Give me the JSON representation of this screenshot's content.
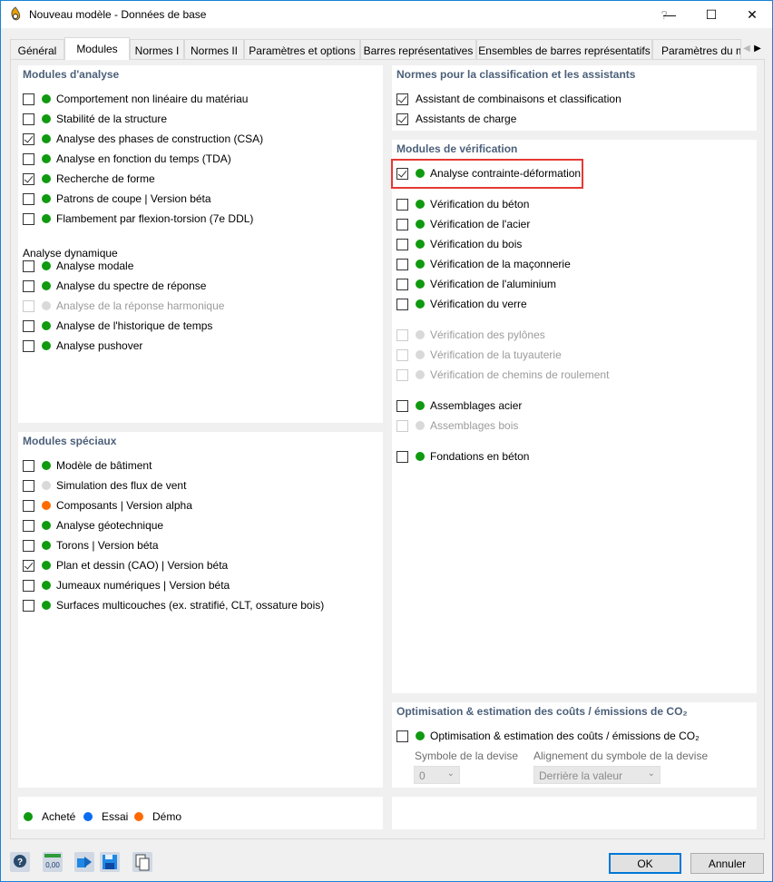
{
  "window": {
    "title": "Nouveau modèle - Données de base",
    "help_glyph": "?",
    "minimize_glyph": "—",
    "maximize_glyph": "☐",
    "close_glyph": "✕"
  },
  "tabs": [
    {
      "label": "Général"
    },
    {
      "label": "Modules",
      "active": true
    },
    {
      "label": "Normes I"
    },
    {
      "label": "Normes II"
    },
    {
      "label": "Paramètres et options"
    },
    {
      "label": "Barres représentatives"
    },
    {
      "label": "Ensembles de barres représentatifs"
    },
    {
      "label": "Paramètres du mo"
    }
  ],
  "analysis_modules": {
    "title": "Modules d'analyse",
    "items": [
      {
        "label": "Comportement non linéaire du matériau",
        "checked": false,
        "status": "green"
      },
      {
        "label": "Stabilité de la structure",
        "checked": false,
        "status": "green"
      },
      {
        "label": "Analyse des phases de construction (CSA)",
        "checked": true,
        "status": "green"
      },
      {
        "label": "Analyse en fonction du temps (TDA)",
        "checked": false,
        "status": "green"
      },
      {
        "label": "Recherche de forme",
        "checked": true,
        "status": "green"
      },
      {
        "label": "Patrons de coupe | Version béta",
        "checked": false,
        "status": "green"
      },
      {
        "label": "Flambement par flexion-torsion (7e DDL)",
        "checked": false,
        "status": "green"
      }
    ],
    "dynamic_title": "Analyse dynamique",
    "dynamic_items": [
      {
        "label": "Analyse modale",
        "checked": false,
        "status": "green"
      },
      {
        "label": "Analyse du spectre de réponse",
        "checked": false,
        "status": "green"
      },
      {
        "label": "Analyse de la réponse harmonique",
        "checked": false,
        "status": "grey",
        "disabled": true
      },
      {
        "label": "Analyse de l'historique de temps",
        "checked": false,
        "status": "green"
      },
      {
        "label": "Analyse pushover",
        "checked": false,
        "status": "green"
      }
    ]
  },
  "special_modules": {
    "title": "Modules spéciaux",
    "items": [
      {
        "label": "Modèle de bâtiment",
        "checked": false,
        "status": "green"
      },
      {
        "label": "Simulation des flux de vent",
        "checked": false,
        "status": "grey"
      },
      {
        "label": "Composants | Version alpha",
        "checked": false,
        "status": "orange"
      },
      {
        "label": "Analyse géotechnique",
        "checked": false,
        "status": "green"
      },
      {
        "label": "Torons | Version béta",
        "checked": false,
        "status": "green"
      },
      {
        "label": "Plan et dessin (CAO) | Version béta",
        "checked": true,
        "status": "green"
      },
      {
        "label": "Jumeaux numériques | Version béta",
        "checked": false,
        "status": "green"
      },
      {
        "label": "Surfaces multicouches (ex. stratifié, CLT, ossature bois)",
        "checked": false,
        "status": "green"
      }
    ]
  },
  "legend": {
    "bought": "Acheté",
    "trial": "Essai",
    "demo": "Démo"
  },
  "norms": {
    "title": "Normes pour la classification et les assistants",
    "items": [
      {
        "label": "Assistant de combinaisons et classification",
        "checked": true
      },
      {
        "label": "Assistants de charge",
        "checked": true
      }
    ]
  },
  "design_modules": {
    "title": "Modules de vérification",
    "items": [
      {
        "label": "Analyse contrainte-déformation",
        "checked": true,
        "status": "green",
        "highlighted": true
      },
      {
        "label": "Vérification du béton",
        "checked": false,
        "status": "green"
      },
      {
        "label": "Vérification de l'acier",
        "checked": false,
        "status": "green"
      },
      {
        "label": "Vérification du bois",
        "checked": false,
        "status": "green"
      },
      {
        "label": "Vérification de la maçonnerie",
        "checked": false,
        "status": "green"
      },
      {
        "label": "Vérification de l'aluminium",
        "checked": false,
        "status": "green"
      },
      {
        "label": "Vérification du verre",
        "checked": false,
        "status": "green"
      },
      {
        "label": "Vérification des pylônes",
        "checked": false,
        "status": "grey",
        "disabled": true
      },
      {
        "label": "Vérification de la tuyauterie",
        "checked": false,
        "status": "grey",
        "disabled": true
      },
      {
        "label": "Vérification de chemins de roulement",
        "checked": false,
        "status": "grey",
        "disabled": true
      },
      {
        "label": "Assemblages acier",
        "checked": false,
        "status": "green"
      },
      {
        "label": "Assemblages bois",
        "checked": false,
        "status": "grey",
        "disabled": true
      },
      {
        "label": "Fondations en béton",
        "checked": false,
        "status": "green"
      }
    ]
  },
  "optimization": {
    "title": "Optimisation & estimation des coûts / émissions de CO₂",
    "checkbox_label": "Optimisation & estimation des coûts / émissions de CO₂",
    "checked": false,
    "currency_label": "Symbole de la devise",
    "currency_value": "0",
    "alignment_label": "Alignement du symbole de la devise",
    "alignment_value": "Derrière la valeur"
  },
  "buttons": {
    "ok": "OK",
    "cancel": "Annuler"
  },
  "bottom_icons": [
    "help-icon",
    "units-icon",
    "import-icon",
    "save-icon",
    "copy-icon"
  ],
  "units_icon_text": "0,00",
  "colors": {
    "accent": "#0078d7",
    "bought": "#0f9a0f",
    "trial": "#0a6cf0",
    "demo": "#ff6a00",
    "section_title": "#4c607a",
    "highlight": "#e53935"
  }
}
